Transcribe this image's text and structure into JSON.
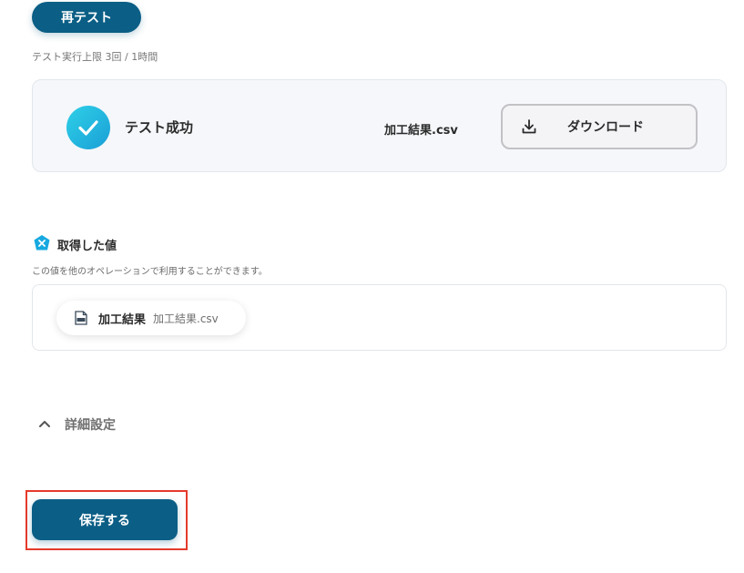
{
  "retest": {
    "label": "再テスト",
    "limit_text": "テスト実行上限 3回 / 1時間"
  },
  "result": {
    "status_text": "テスト成功",
    "file_name": "加工結果.csv",
    "download_label": "ダウンロード"
  },
  "acquired": {
    "title": "取得した値",
    "description": "この値を他のオペレーションで利用することができます。",
    "items": [
      {
        "label": "加工結果",
        "value": "加工結果.csv"
      }
    ]
  },
  "details": {
    "label": "詳細設定"
  },
  "save": {
    "label": "保存する"
  },
  "colors": {
    "primary": "#0b5e85",
    "success_gradient_start": "#2ed0e8",
    "success_gradient_end": "#1a9fd6",
    "highlight": "#e53a2c"
  }
}
